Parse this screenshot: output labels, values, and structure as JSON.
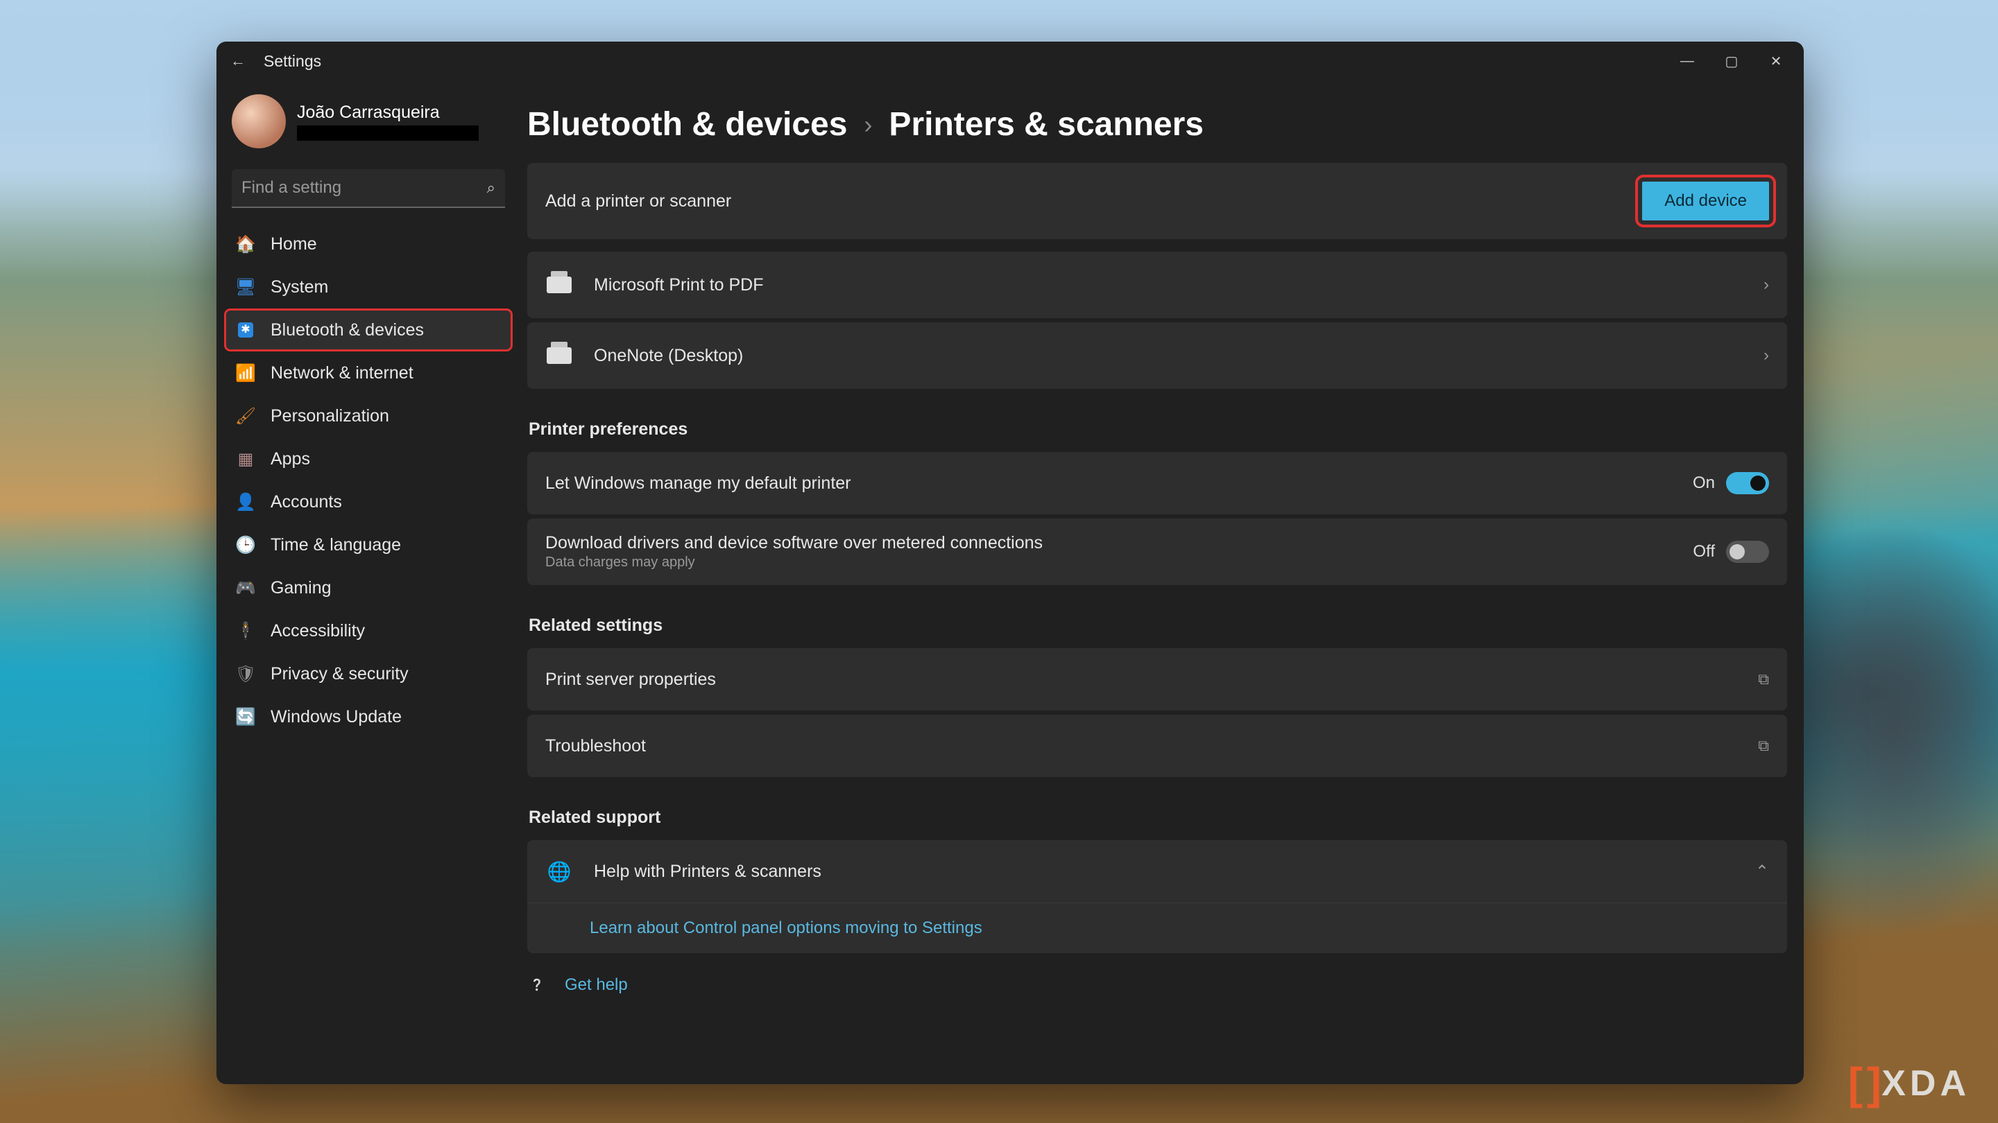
{
  "window": {
    "title": "Settings"
  },
  "profile": {
    "name": "João Carrasqueira"
  },
  "search": {
    "placeholder": "Find a setting"
  },
  "sidebar": {
    "items": [
      {
        "id": "home",
        "label": "Home",
        "color": "#f0a050"
      },
      {
        "id": "system",
        "label": "System",
        "color": "#3a8de0"
      },
      {
        "id": "bluetooth",
        "label": "Bluetooth & devices",
        "color": "#2a88e0",
        "selected": true,
        "highlight": true
      },
      {
        "id": "network",
        "label": "Network & internet",
        "color": "#2ab0d0"
      },
      {
        "id": "personalization",
        "label": "Personalization",
        "color": "#d08030"
      },
      {
        "id": "apps",
        "label": "Apps",
        "color": "#b08888"
      },
      {
        "id": "accounts",
        "label": "Accounts",
        "color": "#3ab060"
      },
      {
        "id": "time",
        "label": "Time & language",
        "color": "#3a90d0"
      },
      {
        "id": "gaming",
        "label": "Gaming",
        "color": "#909090"
      },
      {
        "id": "accessibility",
        "label": "Accessibility",
        "color": "#30a0e0"
      },
      {
        "id": "privacy",
        "label": "Privacy & security",
        "color": "#909090"
      },
      {
        "id": "update",
        "label": "Windows Update",
        "color": "#2a88e0"
      }
    ]
  },
  "breadcrumb": {
    "parent": "Bluetooth & devices",
    "current": "Printers & scanners"
  },
  "add_row": {
    "label": "Add a printer or scanner",
    "button": "Add device"
  },
  "printers": [
    {
      "label": "Microsoft Print to PDF"
    },
    {
      "label": "OneNote (Desktop)"
    }
  ],
  "sections": {
    "prefs": "Printer preferences",
    "related": "Related settings",
    "support": "Related support"
  },
  "prefs": {
    "manage": {
      "label": "Let Windows manage my default printer",
      "state": "On",
      "on": true
    },
    "metered": {
      "label": "Download drivers and device software over metered connections",
      "sub": "Data charges may apply",
      "state": "Off",
      "on": false
    }
  },
  "related": {
    "server": "Print server properties",
    "troubleshoot": "Troubleshoot"
  },
  "support": {
    "help": "Help with Printers & scanners",
    "link": "Learn about Control panel options moving to Settings"
  },
  "bottom": {
    "gethelp": "Get help"
  },
  "watermark": "XDA"
}
